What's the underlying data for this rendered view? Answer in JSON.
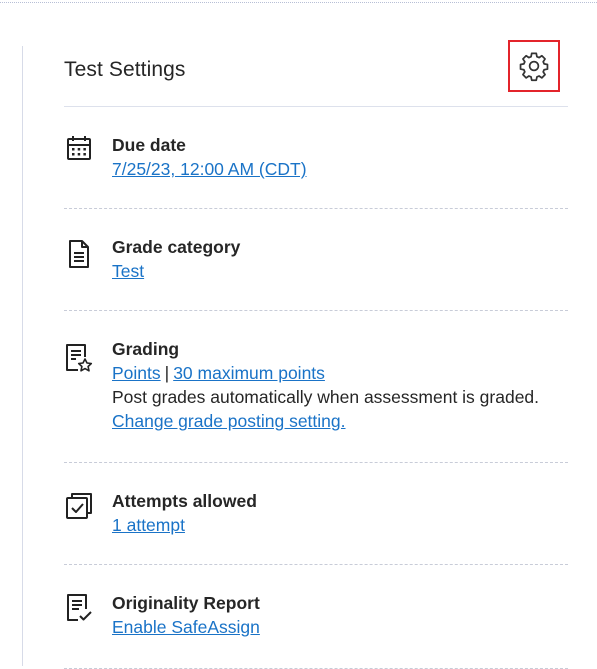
{
  "panel": {
    "title": "Test Settings",
    "settings_icon": "gear-icon"
  },
  "items": {
    "due_date": {
      "icon": "calendar-icon",
      "title": "Due date",
      "link": "7/25/23, 12:00 AM (CDT)"
    },
    "grade_category": {
      "icon": "document-icon",
      "title": "Grade category",
      "link": "Test"
    },
    "grading": {
      "icon": "grading-star-icon",
      "title": "Grading",
      "points_link": "Points",
      "separator": "|",
      "max_points_link": "30 maximum points",
      "description": "Post grades automatically when assessment is graded.",
      "change_link": "Change grade posting setting."
    },
    "attempts": {
      "icon": "attempts-check-icon",
      "title": "Attempts allowed",
      "link": "1 attempt"
    },
    "originality": {
      "icon": "originality-report-icon",
      "title": "Originality Report",
      "link": "Enable SafeAssign"
    }
  },
  "colors": {
    "link": "#1a73c7",
    "highlight": "#e3242b",
    "text": "#262626"
  }
}
